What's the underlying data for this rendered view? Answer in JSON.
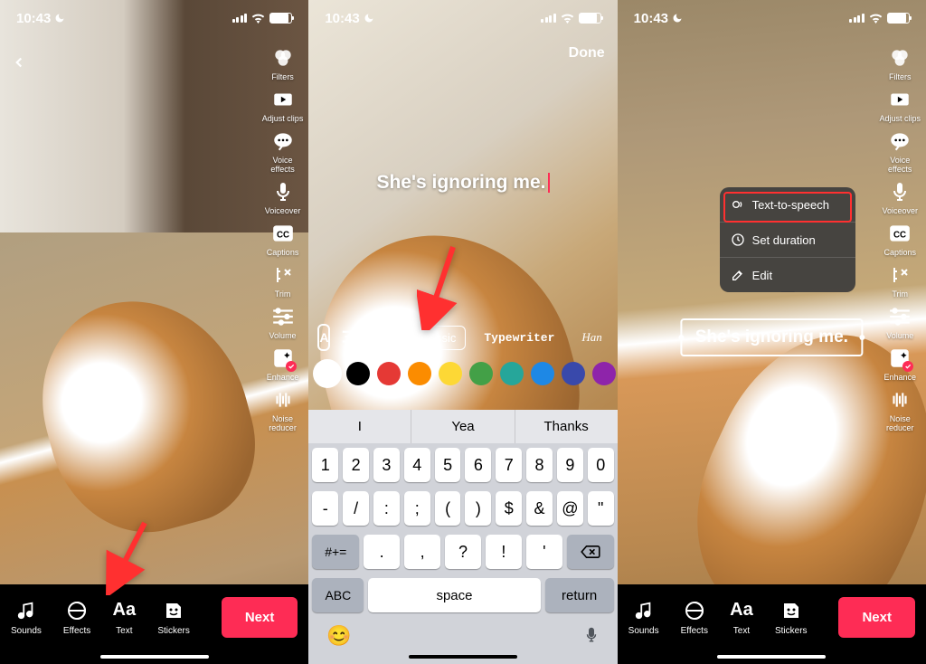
{
  "status": {
    "time": "10:43"
  },
  "side_tools": [
    {
      "id": "filters",
      "label": "Filters"
    },
    {
      "id": "adjust",
      "label": "Adjust clips"
    },
    {
      "id": "voice_effects",
      "label": "Voice\neffects"
    },
    {
      "id": "voiceover",
      "label": "Voiceover"
    },
    {
      "id": "captions",
      "label": "Captions"
    },
    {
      "id": "trim",
      "label": "Trim"
    },
    {
      "id": "volume",
      "label": "Volume"
    },
    {
      "id": "enhance",
      "label": "Enhance"
    },
    {
      "id": "noise",
      "label": "Noise\nreducer"
    }
  ],
  "bottom_tools": [
    {
      "id": "sounds",
      "label": "Sounds"
    },
    {
      "id": "effects",
      "label": "Effects"
    },
    {
      "id": "text",
      "label": "Text"
    },
    {
      "id": "stickers",
      "label": "Stickers"
    }
  ],
  "next_label": "Next",
  "done_label": "Done",
  "entered_text": "She's ignoring me.",
  "font_options": [
    {
      "id": "classic",
      "label": "Classic",
      "selected": true
    },
    {
      "id": "typewriter",
      "label": "Typewriter",
      "selected": false
    },
    {
      "id": "handwriting",
      "label": "Han",
      "selected": false
    }
  ],
  "colors": [
    "#ffffff",
    "#000000",
    "#e53935",
    "#fb8c00",
    "#fdd835",
    "#43a047",
    "#26a69a",
    "#1e88e5",
    "#3949ab",
    "#8e24aa"
  ],
  "selected_color_index": 0,
  "keyboard": {
    "suggestions": [
      "I",
      "Yea",
      "Thanks"
    ],
    "row1": [
      "1",
      "2",
      "3",
      "4",
      "5",
      "6",
      "7",
      "8",
      "9",
      "0"
    ],
    "row2": [
      "-",
      "/",
      ":",
      ";",
      "(",
      ")",
      "$",
      "&",
      "@",
      "\""
    ],
    "row3_shift": "#+=",
    "row3": [
      ".",
      ",",
      "?",
      "!",
      "'"
    ],
    "abc": "ABC",
    "space": "space",
    "return": "return"
  },
  "context_menu": [
    {
      "id": "tts",
      "label": "Text-to-speech"
    },
    {
      "id": "duration",
      "label": "Set duration"
    },
    {
      "id": "edit",
      "label": "Edit"
    }
  ]
}
